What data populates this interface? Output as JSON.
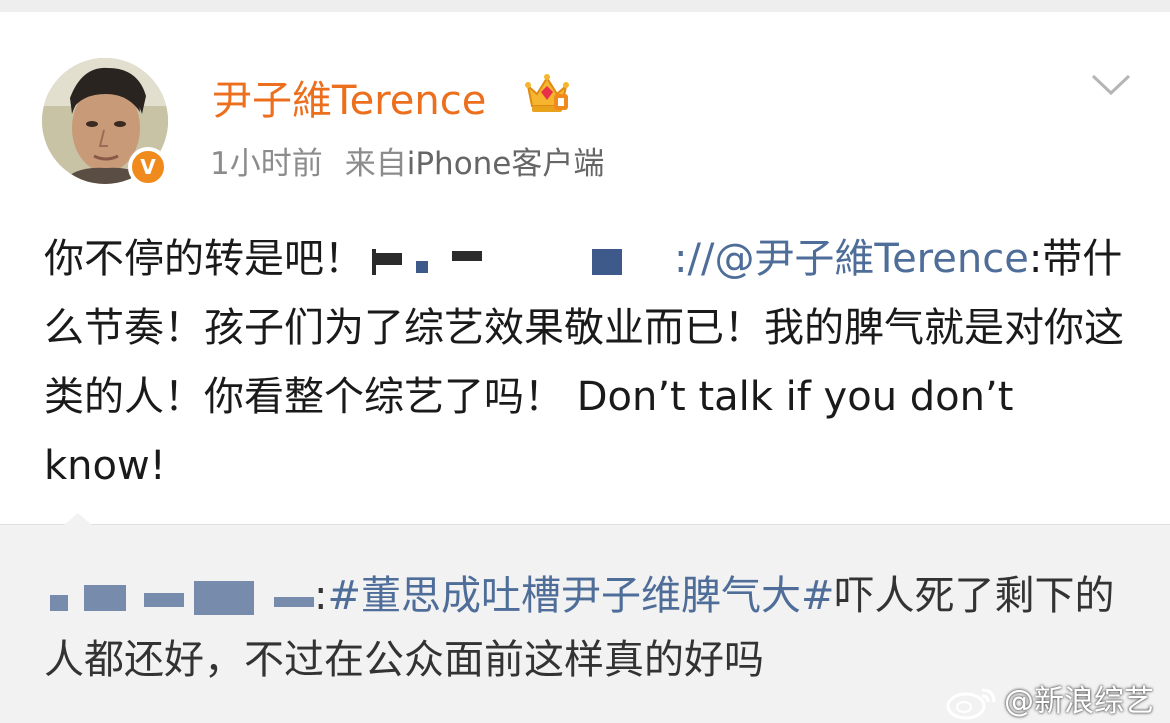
{
  "post": {
    "user_name": "尹子維Terence",
    "time": "1小时前",
    "source_prefix": "来自",
    "source_client": "iPhone客户端",
    "text_before": "你不停的转是吧！",
    "text_after_mask": "://",
    "mention": "@尹子維Terence",
    "text_body": ":带什么节奏！孩子们为了综艺效果敬业而已！我的脾气就是对你这类的人！你看整个综艺了吗！ Don’t talk if you don’t know!"
  },
  "retweet": {
    "separator": ":",
    "hashtag": "#董思成吐槽尹子维脾气大#",
    "text": "吓人死了剩下的人都还好，不过在公众面前这样真的好吗"
  },
  "watermark": {
    "text": "@新浪综艺"
  },
  "icons": {
    "crown": "crown-vip-icon",
    "verified": "verified-v-icon",
    "menu": "chevron-down-icon",
    "weibo_logo": "weibo-logo-icon"
  },
  "colors": {
    "name_orange": "#ec6f1e",
    "link_blue": "#4f6d99",
    "verified_orange": "#f08a1c"
  },
  "badges": {
    "verified_letter": "V"
  }
}
